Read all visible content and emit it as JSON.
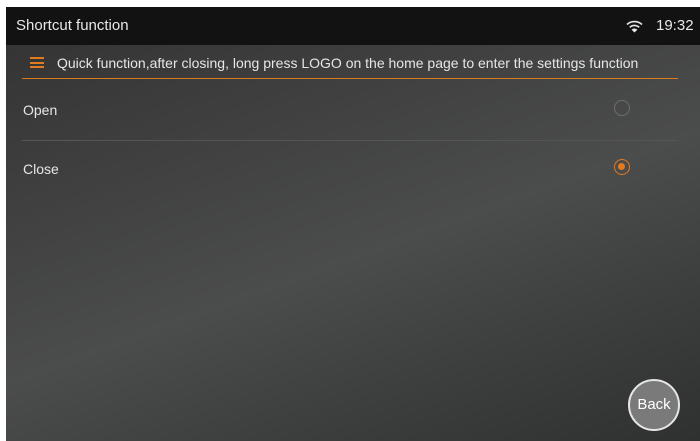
{
  "statusbar": {
    "title": "Shortcut function",
    "time": "19:32",
    "wifi_icon": "wifi-icon"
  },
  "info": {
    "icon": "menu-icon",
    "text": "Quick function,after closing, long press LOGO on the home page to enter the settings function"
  },
  "options": [
    {
      "label": "Open",
      "selected": false
    },
    {
      "label": "Close",
      "selected": true
    }
  ],
  "back_label": "Back",
  "colors": {
    "accent": "#e4791d",
    "statusbar_bg": "#121212",
    "background": "#444545"
  }
}
